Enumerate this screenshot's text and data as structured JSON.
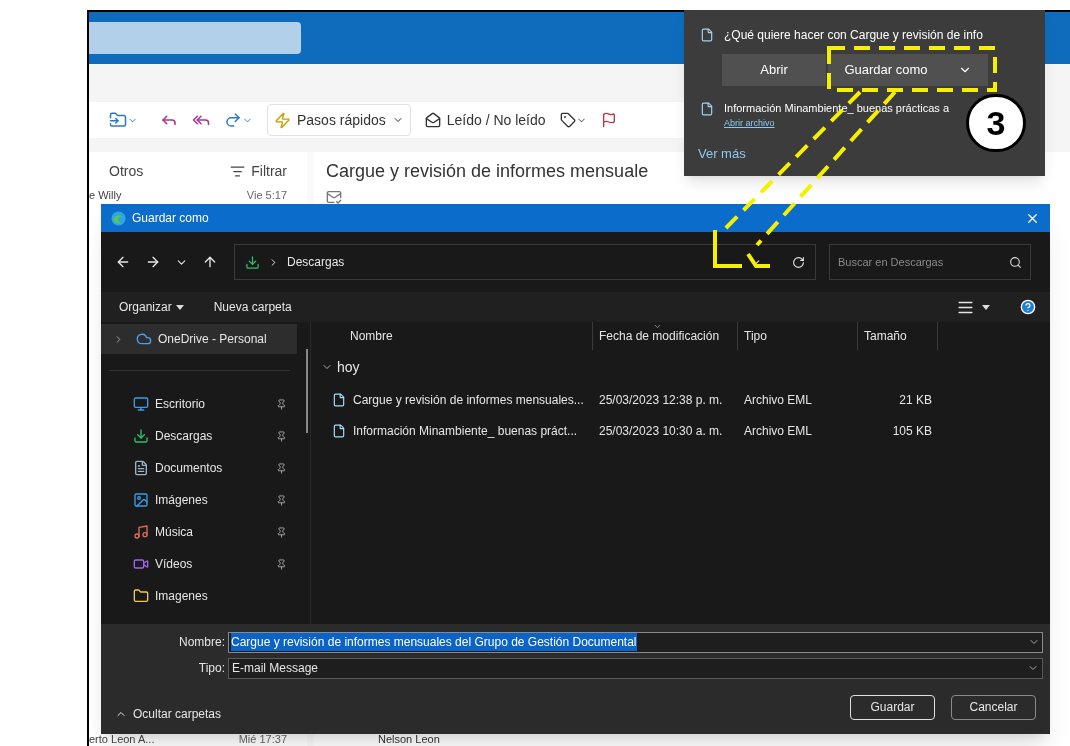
{
  "outlook": {
    "toolbar": {
      "quick_steps": "Pasos rápidos",
      "read_unread": "Leído / No leído"
    },
    "list": {
      "tab": "Otros",
      "filter": "Filtrar",
      "messages": [
        {
          "sender": "e Willy",
          "time": "Vie 5:17"
        },
        {
          "sender": "erto Leon A...",
          "time": "Mié 17:37"
        }
      ]
    },
    "reading": {
      "subject": "Cargue y revisión de informes mensuale",
      "sender": "Nelson Leon"
    }
  },
  "download_popup": {
    "prompt": "¿Qué quiere hacer con Cargue y revisión de info",
    "actions": [
      "Abrir",
      "Guardar como"
    ],
    "item": {
      "name": "Información Minambiente_ buenas prácticas a",
      "link": "Abrir archivo"
    },
    "more": "Ver más"
  },
  "dialog": {
    "title": "Guardar como",
    "path": "Descargas",
    "search_placeholder": "Buscar en Descargas",
    "organize": "Organizar",
    "new_folder": "Nueva carpeta",
    "nav": [
      {
        "label": "OneDrive - Personal",
        "kind": "drive",
        "selected": true,
        "pinned": false
      },
      {
        "label": "Escritorio",
        "kind": "folder",
        "selected": false,
        "pinned": true
      },
      {
        "label": "Descargas",
        "kind": "folder",
        "selected": false,
        "pinned": true
      },
      {
        "label": "Documentos",
        "kind": "folder",
        "selected": false,
        "pinned": true
      },
      {
        "label": "Imágenes",
        "kind": "folder",
        "selected": false,
        "pinned": true
      },
      {
        "label": "Música",
        "kind": "folder",
        "selected": false,
        "pinned": true
      },
      {
        "label": "Vídeos",
        "kind": "folder",
        "selected": false,
        "pinned": true
      },
      {
        "label": "Imagenes",
        "kind": "folder",
        "selected": false,
        "pinned": false
      }
    ],
    "columns": [
      {
        "label": "Nombre",
        "sorted": false
      },
      {
        "label": "Fecha de modificación",
        "sorted": true
      },
      {
        "label": "Tipo",
        "sorted": false
      },
      {
        "label": "Tamaño",
        "sorted": false
      }
    ],
    "group": "hoy",
    "files": [
      {
        "name": "Cargue y revisión de informes mensuales...",
        "date": "25/03/2023 12:38 p. m.",
        "type": "Archivo EML",
        "size": "21 KB"
      },
      {
        "name": "Información Minambiente_ buenas práct...",
        "date": "25/03/2023 10:30 a. m.",
        "type": "Archivo EML",
        "size": "105 KB"
      }
    ],
    "filename_label": "Nombre:",
    "filename": "Cargue y revisión de informes mensuales del Grupo de Gestión Documental",
    "type_label": "Tipo:",
    "type": "E-mail Message",
    "toggle": "Ocultar carpetas",
    "buttons": [
      {
        "label": "Guardar",
        "default": true
      },
      {
        "label": "Cancelar",
        "default": false
      }
    ]
  },
  "annotation": {
    "label": "3"
  }
}
